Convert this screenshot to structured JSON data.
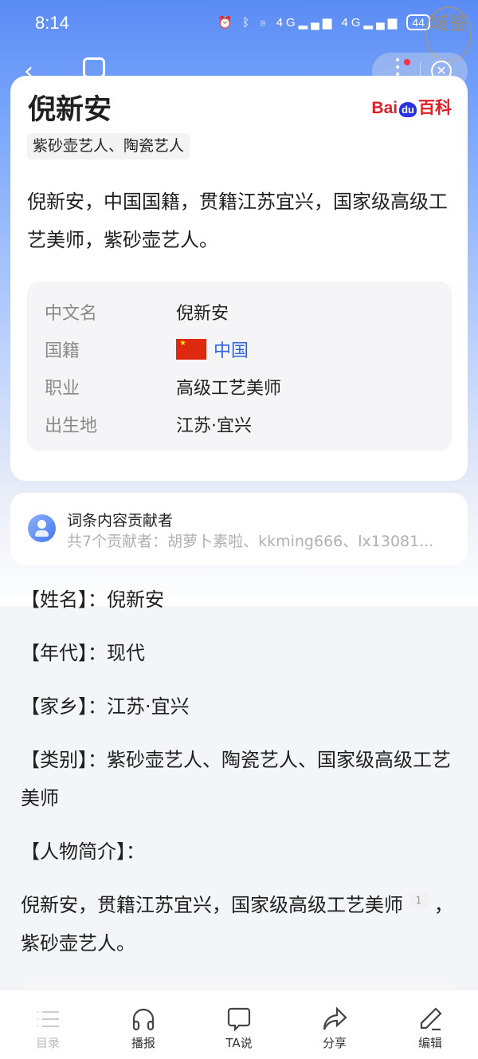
{
  "status": {
    "time": "8:14",
    "signal1": "4G",
    "signal2": "4G",
    "battery": "44"
  },
  "watermark": "域鉴",
  "entry": {
    "title": "倪新安",
    "logo": {
      "bai": "Bai",
      "du": "du",
      "baike": "百科"
    },
    "tag": "紫砂壶艺人、陶瓷艺人",
    "description": "倪新安，中国国籍，贯籍江苏宜兴，国家级高级工艺美师，紫砂壶艺人。",
    "info": [
      {
        "label": "中文名",
        "value": "倪新安"
      },
      {
        "label": "国籍",
        "value": "中国",
        "flag": "china-flag"
      },
      {
        "label": "职业",
        "value": "高级工艺美师"
      },
      {
        "label": "出生地",
        "value": "江苏·宜兴"
      }
    ]
  },
  "contributors": {
    "title": "词条内容贡献者",
    "summary": "共7个贡献者：胡萝卜素啦、kkming666、lx13081..."
  },
  "body": {
    "p1": "【姓名】：倪新安",
    "p2": "【年代】：现代",
    "p3": "【家乡】：江苏·宜兴",
    "p4": "【类别】：紫砂壶艺人、陶瓷艺人、国家级高级工艺美师",
    "p5": "【人物简介】：",
    "p6a": "倪新安，贯籍江苏宜兴，国家级高级工艺美师",
    "ref": "1",
    "p6b": "，紫砂壶艺人。"
  },
  "tabbar": [
    {
      "label": "目录",
      "icon": "list-icon"
    },
    {
      "label": "播报",
      "icon": "headphones-icon"
    },
    {
      "label": "TA说",
      "icon": "chat-bubble-icon"
    },
    {
      "label": "分享",
      "icon": "share-icon"
    },
    {
      "label": "编辑",
      "icon": "edit-icon"
    }
  ],
  "colors": {
    "accent": "#2d63e0",
    "header": "#5b8cf5",
    "baidu_red": "#de1f26",
    "baidu_blue": "#2932e1"
  }
}
